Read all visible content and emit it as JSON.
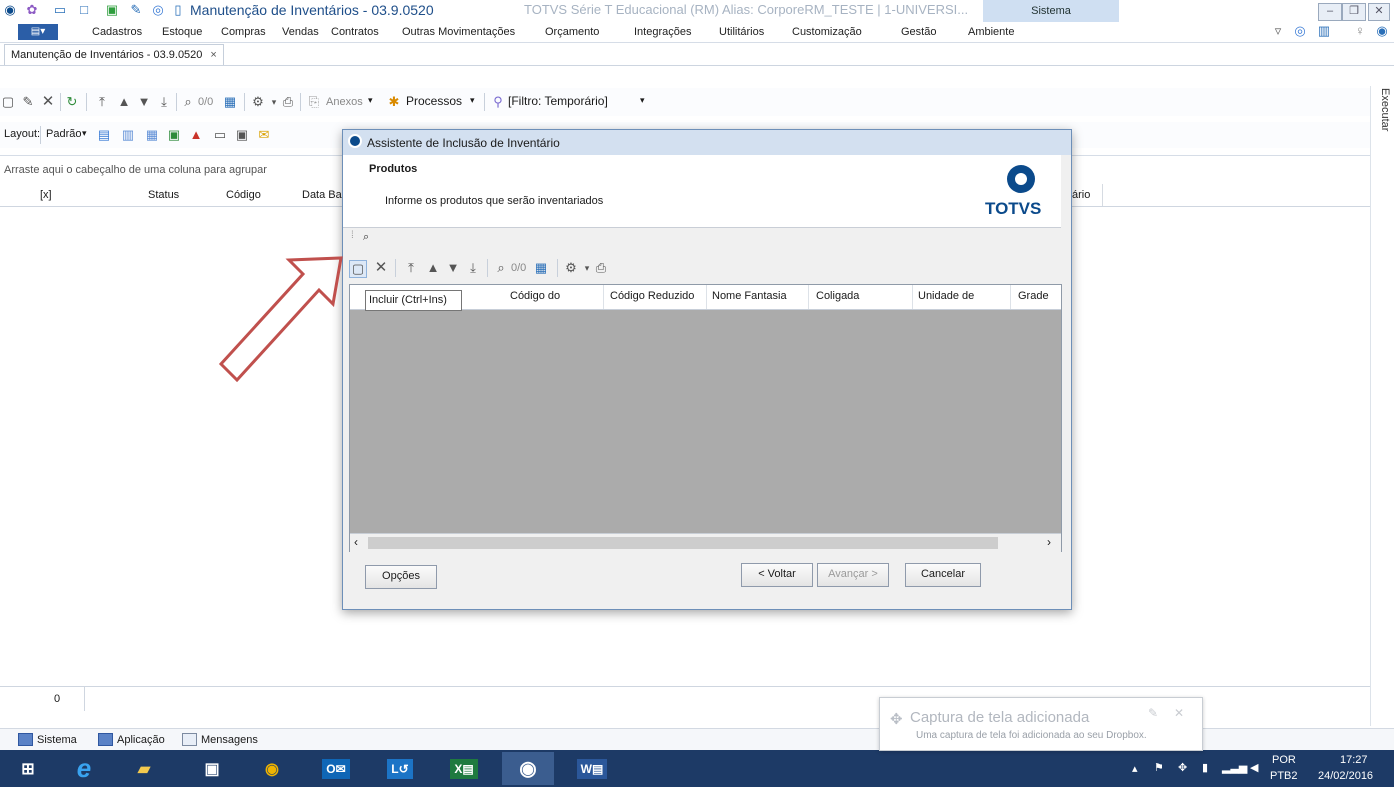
{
  "titlebar": {
    "title": "Manutenção de Inventários - 03.9.0520",
    "subtitle": "TOTVS Série T Educacional (RM)  Alias:  CorporeRM_TESTE  |  1-UNIVERSI...",
    "context_tab": "Sistema"
  },
  "menu": {
    "items": [
      "Cadastros",
      "Estoque",
      "Compras",
      "Vendas",
      "Contratos",
      "Outras Movimentações",
      "Orçamento",
      "Integrações",
      "Utilitários",
      "Customização",
      "Gestão",
      "Ambiente"
    ]
  },
  "doc_tab": {
    "label": "Manutenção de Inventários - 03.9.0520",
    "close": "×"
  },
  "toolbar": {
    "record_count": "0/0",
    "anexos": "Anexos",
    "processos": "Processos",
    "filtro": "[Filtro: Temporário]",
    "executar": "Executar"
  },
  "layout_bar": {
    "label": "Layout:",
    "padrao": "Padrão"
  },
  "grid": {
    "group_hint": "Arraste aqui o cabeçalho de uma coluna para agrupar",
    "columns": [
      "[x]",
      "Status",
      "Código",
      "Data Ba"
    ],
    "extra_column": "ário",
    "footer_count": "0"
  },
  "dialog": {
    "title": "Assistente de Inclusão de Inventário",
    "heading": "Produtos",
    "description": "Informe os produtos que serão inventariados",
    "logo_text": "TOTVS",
    "record_count": "0/0",
    "columns": [
      "Código do",
      "Código Reduzido",
      "Nome Fantasia",
      "Coligada",
      "Unidade de",
      "Grade"
    ],
    "tooltip": "Incluir (Ctrl+Ins)",
    "buttons": {
      "options": "Opções",
      "back": "< Voltar",
      "next": "Avançar >",
      "cancel": "Cancelar"
    }
  },
  "bottom_tabs": [
    "Sistema",
    "Aplicação",
    "Mensagens"
  ],
  "toast": {
    "title": "Captura de tela adicionada",
    "body": "Uma captura de tela foi adicionada ao seu Dropbox."
  },
  "tray": {
    "lang1": "POR",
    "lang2": "PTB2",
    "time": "17:27",
    "date": "24/02/2016"
  },
  "colors": {
    "accent": "#2a6fb8",
    "taskbar": "#1d3a66",
    "arrow": "#c0504d",
    "totvs_blue": "#0b4a8b"
  }
}
